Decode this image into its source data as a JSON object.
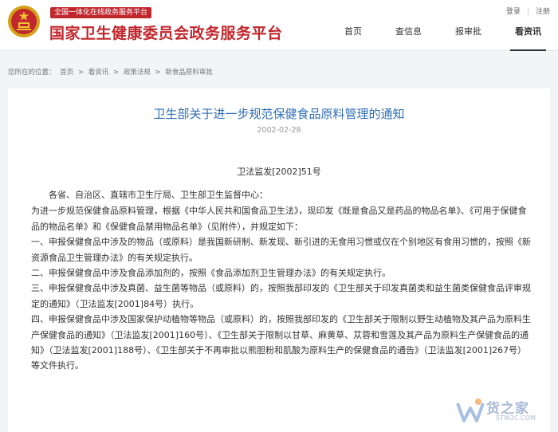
{
  "header": {
    "badge": "全国一体化在线政务服务平台",
    "site_title": "国家卫生健康委员会政务服务平台",
    "login": "登录",
    "register": "注册",
    "nav": [
      "首页",
      "查信息",
      "报审批",
      "看资讯"
    ],
    "active_nav": "看资讯"
  },
  "breadcrumb": {
    "prefix": "您所在的位置：",
    "items": [
      "首页",
      "看资讯",
      "政策法规",
      "新食品原料审批"
    ],
    "separator": ">"
  },
  "article": {
    "title": "卫生部关于进一步规范保健食品原料管理的通知",
    "date": "2002-02-28",
    "doc_number": "卫法监发[2002]51号",
    "addressee": "各省、自治区、直辖市卫生厅局、卫生部卫生监督中心：",
    "paragraphs": [
      "为进一步规范保健食品原料管理，根据《中华人民共和国食品卫生法》，现印发《既是食品又是药品的物品名单》、《可用于保健食品的物品名单》和《保健食品禁用物品名单》（见附件），并规定如下：",
      "一、申报保健食品中涉及的物品（或原料）是我国新研制、新发现、新引进的无食用习惯或仅在个别地区有食用习惯的，按照《新资源食品卫生管理办法》的有关规定执行。",
      "二、申报保健食品中涉及食品添加剂的，按照《食品添加剂卫生管理办法》的有关规定执行。",
      "三、申报保健食品中涉及真菌、益生菌等物品（或原料）的，按照我部印发的《卫生部关于印发真菌类和益生菌类保健食品评审规定的通知》（卫法监发[2001]84号）执行。",
      "四、申报保健食品中涉及国家保护动植物等物品（或原料）的，按照我部印发的《卫生部关于限制以野生动植物及其产品为原料生产保健食品的通知》（卫法监发[2001]160号）、《卫生部关于限制以甘草、麻黄草、苁蓉和雪莲及其产品为原料生产保健食品的通知》（卫法监发[2001]188号）、《卫生部关于不再审批以熊胆粉和肌酸为原料生产的保健食品的通告》（卫法监发[2001]267号）等文件执行。"
    ]
  },
  "watermark": {
    "text": "货之家",
    "sub": "5TW2C.COM"
  },
  "colors": {
    "brand_red": "#c1272d",
    "title_blue": "#2e6db4"
  }
}
